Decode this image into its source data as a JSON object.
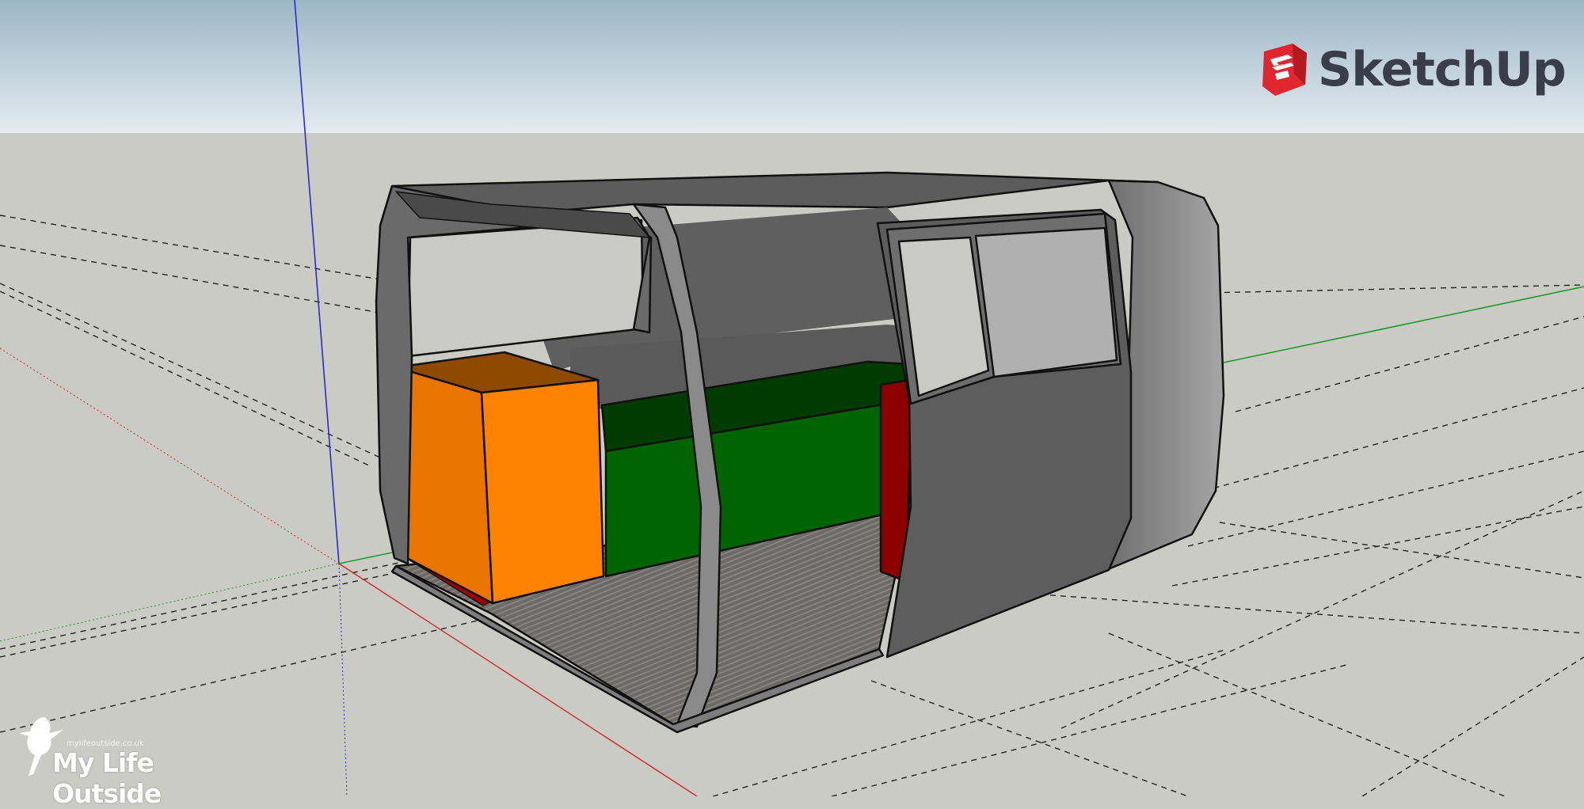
{
  "app": {
    "brand_name": "SketchUp",
    "brand_icon": "sketchup-logo-icon",
    "brand_color": "#e0262e"
  },
  "watermark": {
    "site": "mylifeoutside.co.uk",
    "title": "My Life Outside",
    "icon": "bird-silhouette-icon"
  },
  "scene": {
    "sky_top_color": "#9cb6c6",
    "sky_bottom_color": "#e4ecf0",
    "ground_color": "#cbcbc6",
    "axis_colors": {
      "x": "#d22828",
      "y": "#1f9a2a",
      "z": "#2b2bd0"
    },
    "model_colors": {
      "shell_dark": "#5a5a5a",
      "shell_mid": "#7a7a7a",
      "shell_light": "#9b9b9b",
      "cabinet_front": "#ff8200",
      "cabinet_side": "#e97400",
      "cabinet_top": "#8e4a00",
      "bench": "#006400",
      "bench_top": "#003c00",
      "accent_red": "#8c0000",
      "floor": "#6c6a66"
    }
  }
}
